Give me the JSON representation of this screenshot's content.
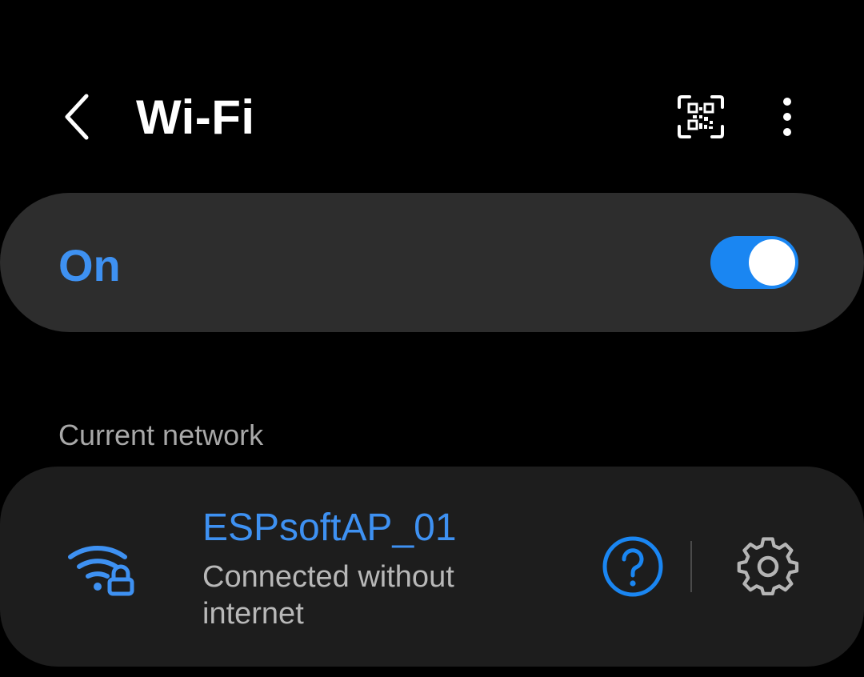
{
  "header": {
    "title": "Wi-Fi",
    "back_icon": "chevron-left-icon",
    "qr_icon": "qr-scan-icon",
    "more_icon": "more-vertical-icon"
  },
  "wifi_toggle": {
    "label": "On",
    "state": "on",
    "accent_color": "#3e91f2",
    "switch_color": "#1a86f2"
  },
  "current_network": {
    "section_label": "Current network",
    "name": "ESPsoftAP_01",
    "status": "Connected without internet",
    "signal_icon": "wifi-lock-icon",
    "help_icon": "question-circle-icon",
    "settings_icon": "gear-icon"
  },
  "colors": {
    "background": "#000000",
    "card": "#2d2d2d",
    "network_card": "#1d1d1d",
    "text_secondary": "#a8a8a8"
  }
}
